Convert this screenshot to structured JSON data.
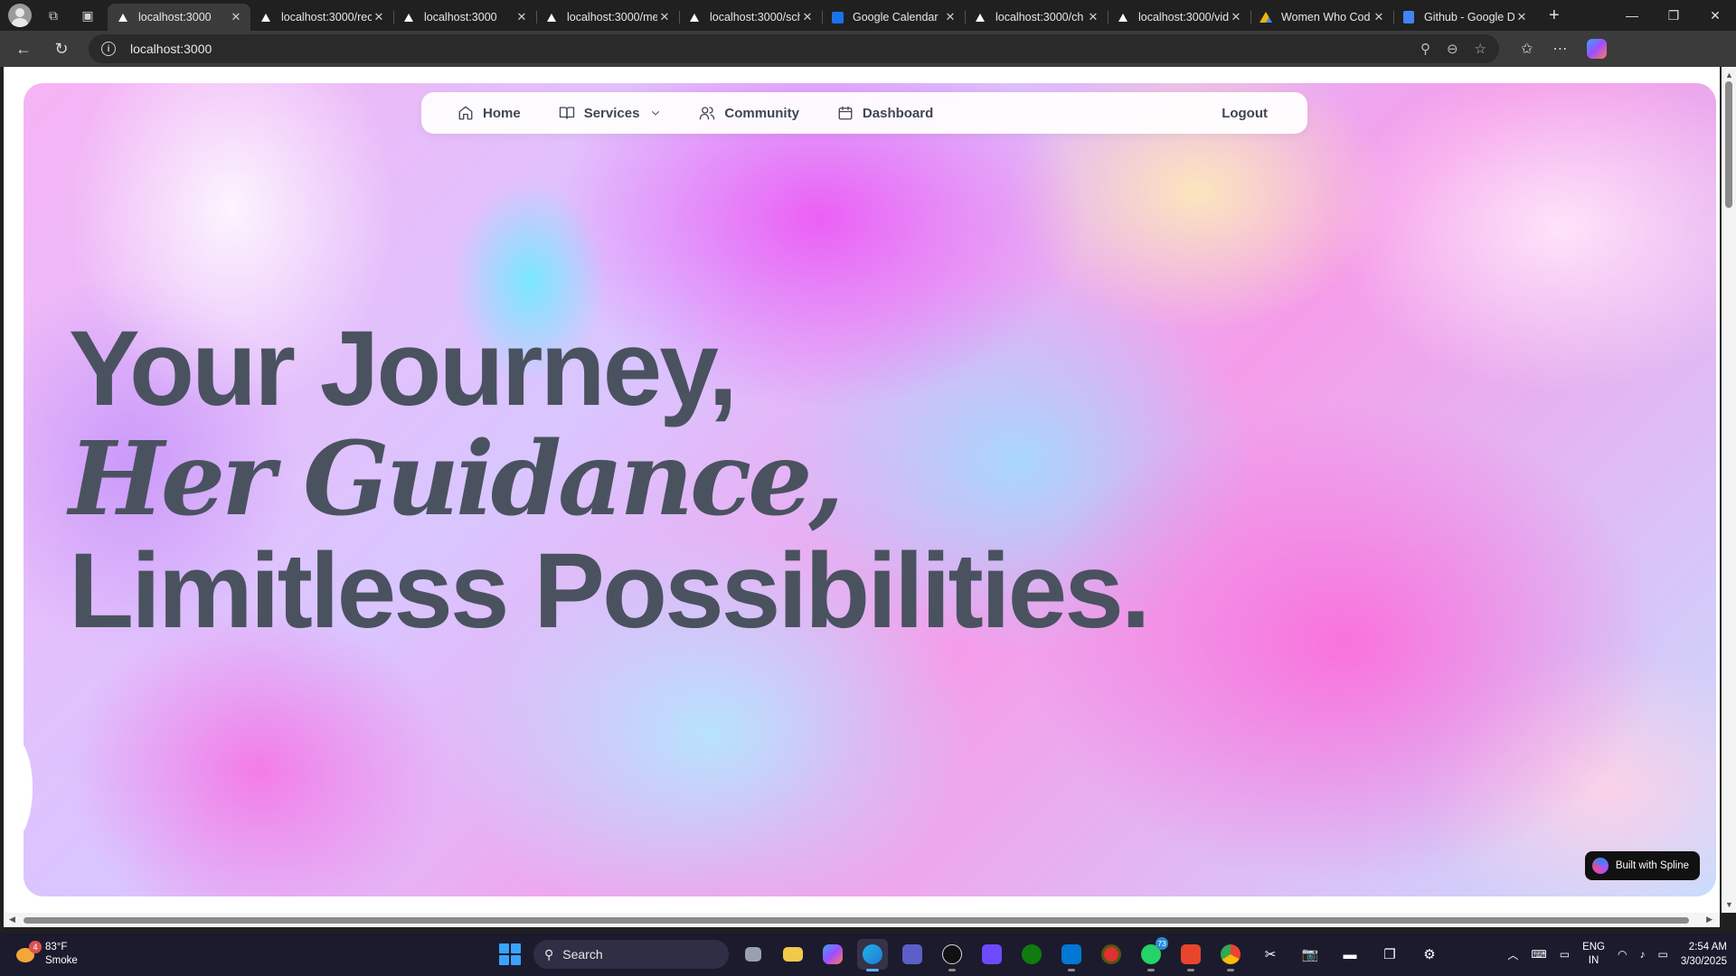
{
  "browser": {
    "tabs": [
      {
        "title": "localhost:3000",
        "favicon": "vercel-triangle-icon",
        "active": true
      },
      {
        "title": "localhost:3000/rec",
        "favicon": "vercel-triangle-icon"
      },
      {
        "title": "localhost:3000",
        "favicon": "vercel-triangle-icon"
      },
      {
        "title": "localhost:3000/me",
        "favicon": "vercel-triangle-icon"
      },
      {
        "title": "localhost:3000/sch",
        "favicon": "vercel-triangle-icon"
      },
      {
        "title": "Google Calendar",
        "favicon": "calendar-icon"
      },
      {
        "title": "localhost:3000/ch",
        "favicon": "vercel-triangle-icon"
      },
      {
        "title": "localhost:3000/vid",
        "favicon": "vercel-triangle-icon"
      },
      {
        "title": "Women Who Cod",
        "favicon": "google-drive-icon"
      },
      {
        "title": "Github - Google D",
        "favicon": "google-docs-icon"
      }
    ],
    "url": "localhost:3000"
  },
  "page": {
    "nav": {
      "home": "Home",
      "services": "Services",
      "community": "Community",
      "dashboard": "Dashboard",
      "logout": "Logout"
    },
    "headline": {
      "line1": "Your Journey,",
      "line2": "Her Guidance,",
      "line3": "Limitless Possibilities."
    },
    "badge": "Built with Spline",
    "colors": {
      "headline": "#4a5260",
      "accent_pink": "#f59ce9",
      "accent_cyan": "#6eebff"
    }
  },
  "taskbar": {
    "weather_temp": "83°F",
    "weather_desc": "Smoke",
    "weather_badge": "4",
    "search_label": "Search",
    "whatsapp_badge": "73",
    "lang_top": "ENG",
    "lang_bottom": "IN",
    "time": "2:54 AM",
    "date": "3/30/2025"
  }
}
